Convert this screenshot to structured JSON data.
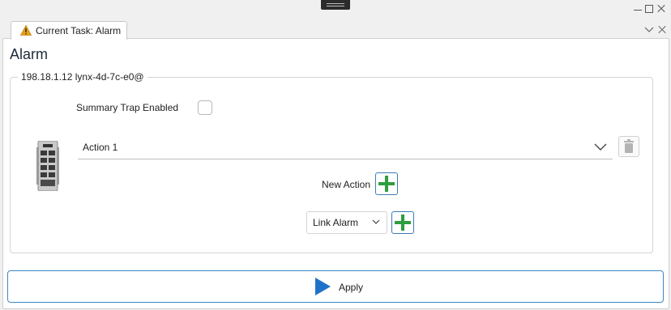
{
  "tab": {
    "title": "Current Task: Alarm"
  },
  "page": {
    "title": "Alarm"
  },
  "group": {
    "legend": "198.18.1.12 lynx-4d-7c-e0@"
  },
  "summary_trap": {
    "label": "Summary Trap Enabled",
    "checked": false
  },
  "action": {
    "selected": "Action 1"
  },
  "new_action": {
    "label": "New Action"
  },
  "link_alarm": {
    "selected": "Link Alarm"
  },
  "apply": {
    "label": "Apply"
  },
  "colors": {
    "accent": "#3b86c7",
    "add_green": "#2e9e3e",
    "apply_blue": "#1e73c8",
    "warning": "#e8a317"
  }
}
